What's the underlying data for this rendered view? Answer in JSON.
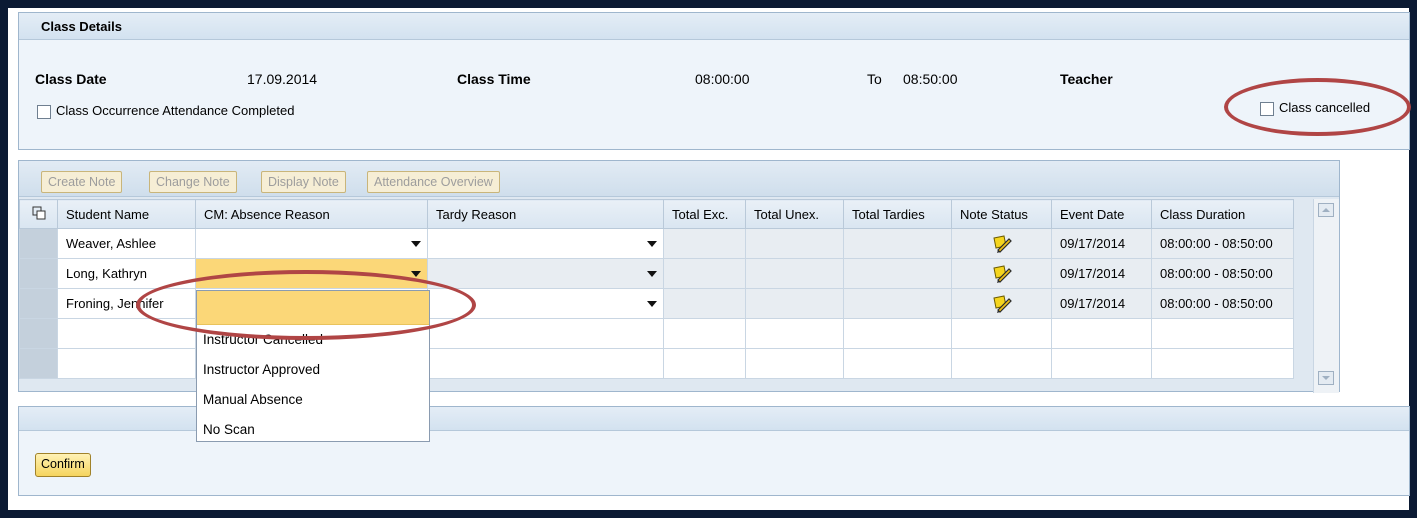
{
  "class_details": {
    "header": "Class Details",
    "class_date_label": "Class Date",
    "class_date": "17.09.2014",
    "class_time_label": "Class Time",
    "class_time_start": "08:00:00",
    "to_label": "To",
    "class_time_end": "08:50:00",
    "teacher_label": "Teacher",
    "attendance_completed_label": "Class Occurrence Attendance Completed",
    "class_cancelled_label": "Class cancelled"
  },
  "toolbar": {
    "create_note": "Create Note",
    "change_note": "Change Note",
    "display_note": "Display Note",
    "attendance_overview": "Attendance Overview"
  },
  "grid": {
    "columns": [
      "Student Name",
      "CM: Absence Reason",
      "Tardy Reason",
      "Total Exc.",
      "Total Unex.",
      "Total Tardies",
      "Note Status",
      "Event Date",
      "Class Duration"
    ],
    "rows": [
      {
        "student": "Weaver, Ashlee",
        "absence_reason": "",
        "tardy_reason": "",
        "total_exc": "",
        "total_unex": "",
        "total_tardies": "",
        "note_status": "note-pencil-icon",
        "event_date": "09/17/2014",
        "class_duration": "08:00:00 - 08:50:00"
      },
      {
        "student": "Long, Kathryn",
        "absence_reason": "",
        "tardy_reason": "",
        "total_exc": "",
        "total_unex": "",
        "total_tardies": "",
        "note_status": "note-pencil-icon",
        "event_date": "09/17/2014",
        "class_duration": "08:00:00 - 08:50:00"
      },
      {
        "student": "Froning, Jennifer",
        "absence_reason": "",
        "tardy_reason": "",
        "total_exc": "",
        "total_unex": "",
        "total_tardies": "",
        "note_status": "note-pencil-icon",
        "event_date": "09/17/2014",
        "class_duration": "08:00:00 - 08:50:00"
      }
    ]
  },
  "absence_dropdown": {
    "options": [
      "Instructor Cancelled",
      "Instructor Approved",
      "Manual Absence",
      "No Scan"
    ]
  },
  "confirm_label": "Confirm",
  "colors": {
    "frame": "#0b1a33",
    "panel": "#eef4fa",
    "highlight": "#fbd778",
    "annotation": "#b04545"
  }
}
